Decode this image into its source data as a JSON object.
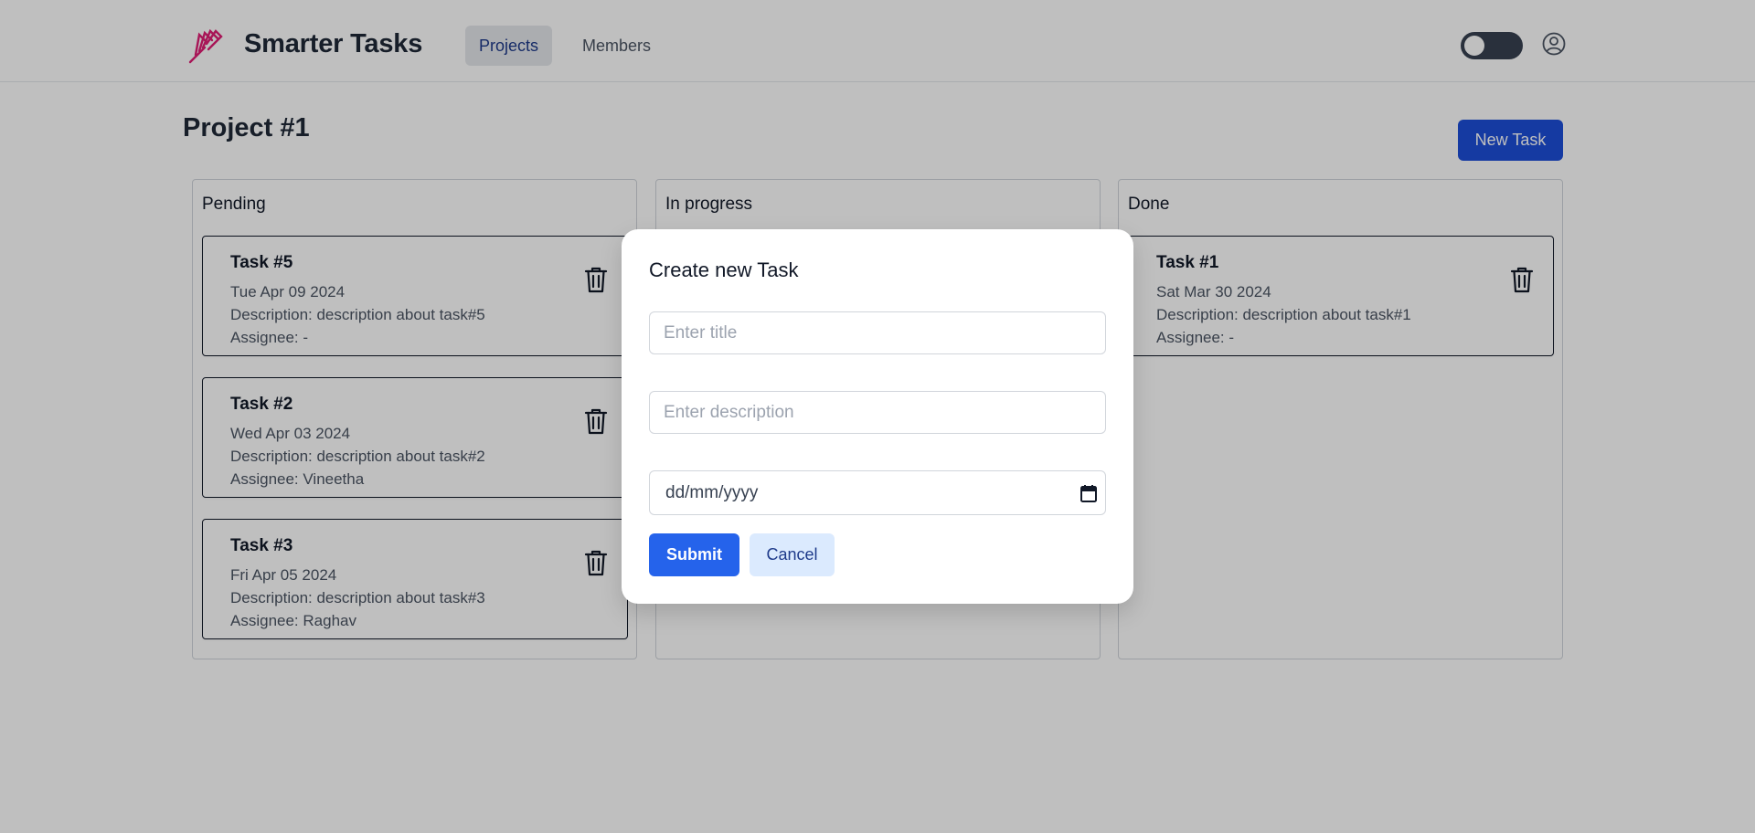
{
  "header": {
    "app_title": "Smarter Tasks",
    "nav": [
      {
        "label": "Projects",
        "active": true
      },
      {
        "label": "Members",
        "active": false
      }
    ],
    "theme_toggle": "dark-mode-toggle",
    "user_icon": "user-circle-icon",
    "logo_icon": "feather-logo-icon"
  },
  "page": {
    "title": "Project #1",
    "new_task_label": "New Task"
  },
  "columns": [
    {
      "title": "Pending",
      "tasks": [
        {
          "title": "Task #5",
          "date": "Tue Apr 09 2024",
          "description": "Description: description about task#5",
          "assignee": "Assignee: -"
        },
        {
          "title": "Task #2",
          "date": "Wed Apr 03 2024",
          "description": "Description: description about task#2",
          "assignee": "Assignee: Vineetha"
        },
        {
          "title": "Task #3",
          "date": "Fri Apr 05 2024",
          "description": "Description: description about task#3",
          "assignee": "Assignee: Raghav"
        }
      ]
    },
    {
      "title": "In progress",
      "tasks": []
    },
    {
      "title": "Done",
      "tasks": [
        {
          "title": "Task #1",
          "date": "Sat Mar 30 2024",
          "description": "Description: description about task#1",
          "assignee": "Assignee: -"
        }
      ]
    }
  ],
  "modal": {
    "title": "Create new Task",
    "title_placeholder": "Enter title",
    "description_placeholder": "Enter description",
    "date_placeholder": "dd/mm/yyyy",
    "submit_label": "Submit",
    "cancel_label": "Cancel"
  },
  "colors": {
    "primary": "#1d4ed8",
    "submit": "#2563eb",
    "cancel_bg": "#dbeafe",
    "logo": "#e11d74"
  }
}
